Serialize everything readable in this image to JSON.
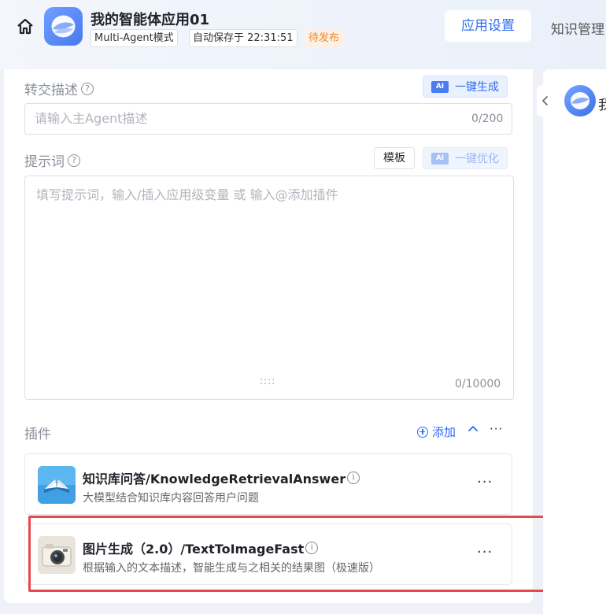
{
  "header": {
    "app_title": "我的智能体应用01",
    "mode_tag": "Multi-Agent模式",
    "autosave": "自动保存于 22:31:51",
    "status": "待发布",
    "tabs": [
      {
        "label": "应用设置",
        "active": true
      },
      {
        "label": "知识管理",
        "active": false
      }
    ]
  },
  "handoff": {
    "label": "转交描述",
    "ai_button": "一键生成",
    "placeholder": "请输入主Agent描述",
    "counter": "0/200"
  },
  "prompt": {
    "label": "提示词",
    "template_button": "模板",
    "ai_button": "一键优化",
    "placeholder": "填写提示词，输入/插入应用级变量 或 输入@添加插件",
    "counter": "0/10000"
  },
  "plugins": {
    "label": "插件",
    "add_label": "添加",
    "items": [
      {
        "name": "知识库问答/KnowledgeRetrievalAnswer",
        "desc": "大模型结合知识库内容回答用户问题",
        "icon": "open-book-icon"
      },
      {
        "name": "图片生成（2.0）/TextToImageFast",
        "desc": "根据输入的文本描述，智能生成与之相关的结果图（极速版）",
        "icon": "camera-icon"
      }
    ]
  },
  "preview": {
    "agent_name": "我"
  },
  "colors": {
    "accent": "#2f6bf2",
    "status_orange": "#f08a24",
    "highlight_red": "#e5484d"
  }
}
